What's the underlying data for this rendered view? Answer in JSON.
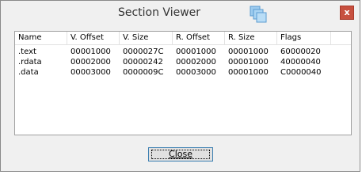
{
  "window": {
    "title": "Section Viewer",
    "close_glyph": "x",
    "app_icon": "copy-windows-icon",
    "close_icon": "close-icon",
    "close_color": "#c7503f"
  },
  "table": {
    "columns": [
      "Name",
      "V. Offset",
      "V. Size",
      "R. Offset",
      "R. Size",
      "Flags",
      ""
    ],
    "rows": [
      [
        ".text",
        "00001000",
        "0000027C",
        "00001000",
        "00001000",
        "60000020"
      ],
      [
        ".rdata",
        "00002000",
        "00000242",
        "00002000",
        "00001000",
        "40000040"
      ],
      [
        ".data",
        "00003000",
        "0000009C",
        "00003000",
        "00001000",
        "C0000040"
      ]
    ]
  },
  "footer": {
    "close_label": "Close"
  }
}
